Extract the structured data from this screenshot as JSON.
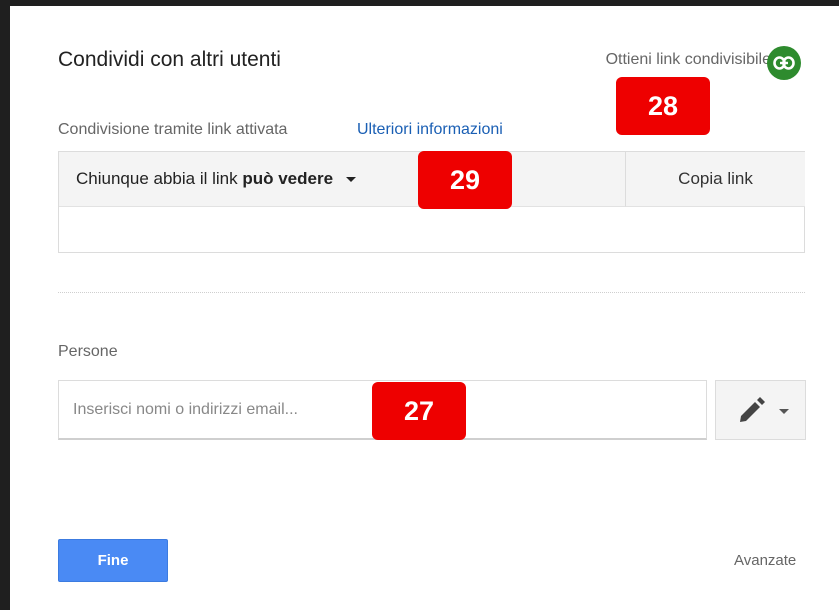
{
  "dialog": {
    "title": "Condividi con altri utenti",
    "get_link_label": "Ottieni link condivisibile",
    "link_status": "Condivisione tramite link attivata",
    "more_info_link": "Ulteriori informazioni",
    "permission": {
      "prefix": "Chiunque abbia il link",
      "level": "può vedere"
    },
    "copy_link_label": "Copia link",
    "link_url": "",
    "people_label": "Persone",
    "email_placeholder": "Inserisci nomi o indirizzi email...",
    "email_value": "",
    "done_label": "Fine",
    "advanced_label": "Avanzate"
  },
  "annotations": {
    "badge_27": "27",
    "badge_28": "28",
    "badge_29": "29"
  },
  "colors": {
    "accent_blue": "#4a8af4",
    "link_green": "#2e8b2e",
    "badge_red": "#ee0000"
  },
  "icons": [
    "link-icon",
    "caret-down-icon",
    "pencil-icon",
    "chevron-down-icon"
  ]
}
